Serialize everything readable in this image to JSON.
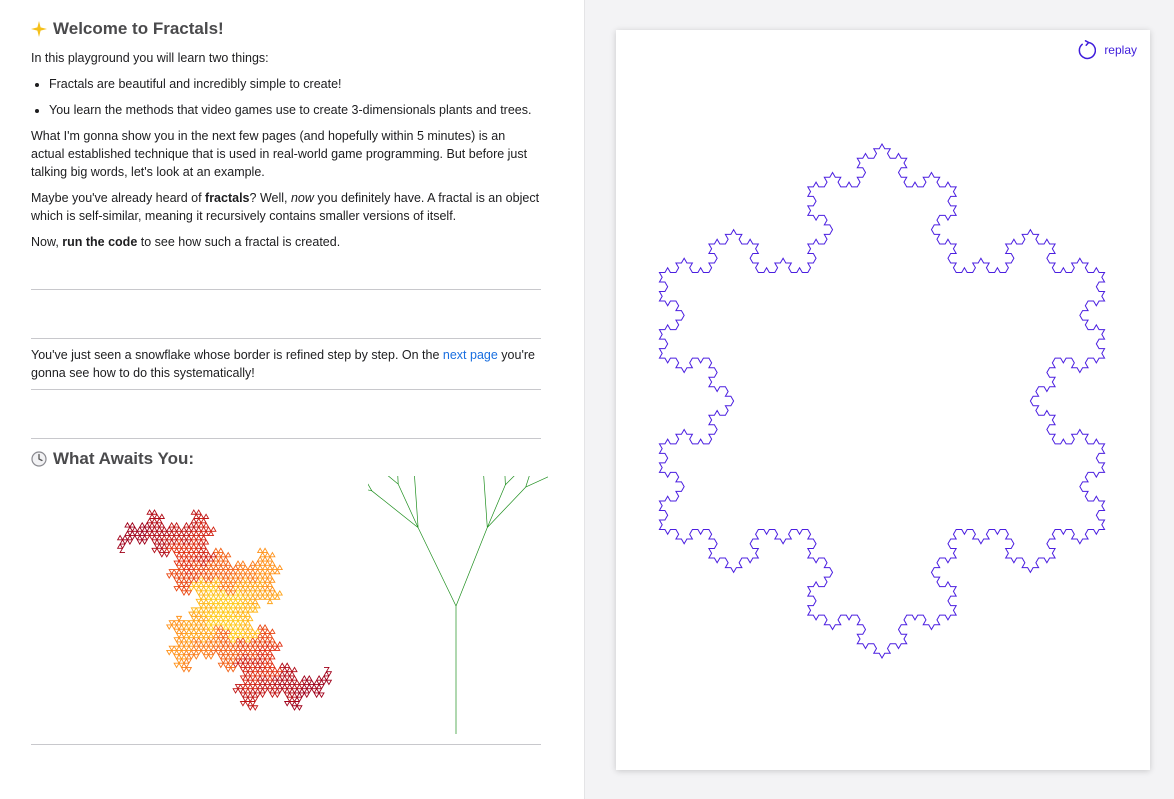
{
  "intro": {
    "title": "Welcome to Fractals!",
    "title_icon": "sparkle-icon",
    "lead": "In this playground you will learn two things:",
    "bullets": [
      "Fractals are beautiful and incredibly simple to create!",
      "You learn the methods that video games use to create 3-dimensionals plants and trees."
    ],
    "para1": "What I'm gonna show you in the next few pages (and hopefully within 5 minutes) is an actual established technique that is used in real-world game programming. But before just talking big words, let's look at an example.",
    "para2_pre": "Maybe you've already heard of ",
    "para2_bold": "fractals",
    "para2_mid": "? Well, ",
    "para2_em": "now",
    "para2_post": " you definitely have. A fractal is an object which is self-similar, meaning it recursively contains smaller versions of itself.",
    "para3_pre": "Now, ",
    "para3_bold": "run the code",
    "para3_post": " to see how such a fractal is created."
  },
  "result": {
    "text_pre": "You've just seen a snowflake whose border is refined step by step. On the ",
    "link": "next page",
    "text_post": " you're gonna see how to do this systematically!"
  },
  "preview": {
    "title": "What Awaits You:",
    "title_icon": "clock-icon"
  },
  "live_view": {
    "replay_label": "replay",
    "replay_icon": "replay-icon",
    "snowflake_color": "#4b1fe0",
    "snowflake_iterations": 4
  },
  "colors": {
    "link": "#1a6fe0",
    "dragon_gradient": [
      "#a0001a",
      "#e02a10",
      "#ff8c1a",
      "#ffd21a"
    ],
    "tree": "#1f8f1f"
  }
}
